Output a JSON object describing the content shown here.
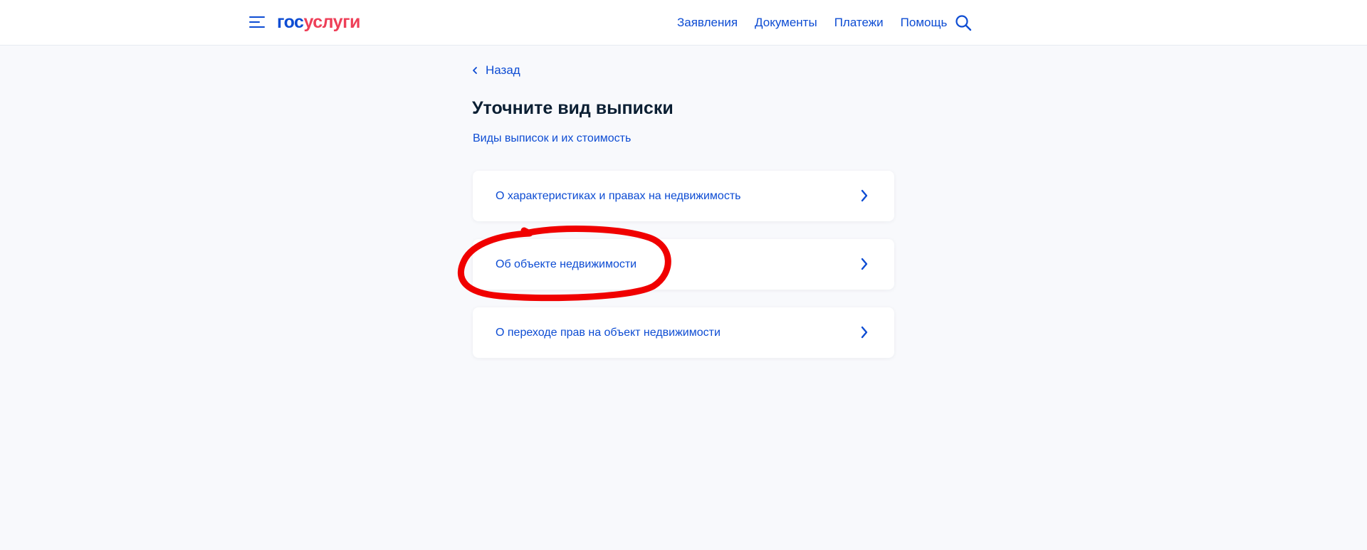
{
  "header": {
    "logo_part1": "гос",
    "logo_part2": "услуги",
    "nav": [
      "Заявления",
      "Документы",
      "Платежи",
      "Помощь"
    ]
  },
  "back_label": "Назад",
  "page_title": "Уточните вид выписки",
  "info_link": "Виды выписок и их стоимость",
  "options": [
    {
      "label": "О характеристиках и правах на недвижимость"
    },
    {
      "label": "Об объекте недвижимости"
    },
    {
      "label": "О переходе прав на объект недвижимости"
    }
  ],
  "icons": {
    "menu": "burger-menu-icon",
    "search": "search-icon",
    "back": "chevron-left-icon",
    "option_arrow": "chevron-right-icon"
  },
  "colors": {
    "primary": "#0d4cd3",
    "logo_red": "#ee3f58",
    "title": "#0b1f33",
    "background": "#f8f9fc",
    "annotation": "#f00000"
  }
}
